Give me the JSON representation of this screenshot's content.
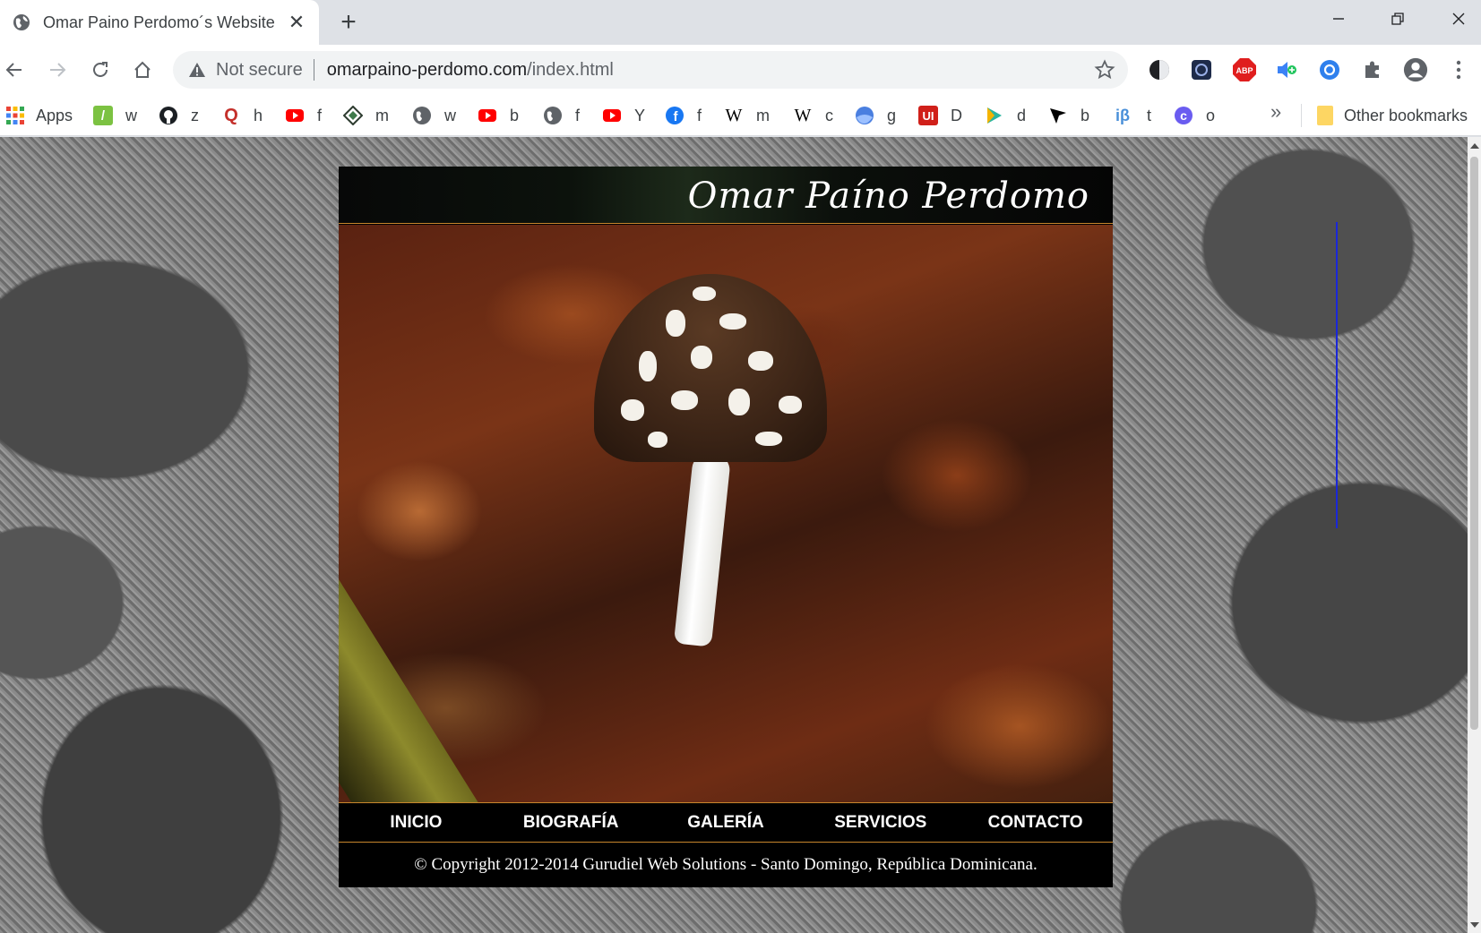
{
  "browser": {
    "tab_title": "Omar Paino Perdomo´s Website",
    "security_label": "Not secure",
    "url_host": "omarpaino-perdomo.com",
    "url_path": "/index.html"
  },
  "bookmarks": {
    "apps_label": "Apps",
    "items": [
      {
        "icon": "green-pencil-icon",
        "label": "w"
      },
      {
        "icon": "github-icon",
        "label": "z"
      },
      {
        "icon": "q-icon",
        "label": "h"
      },
      {
        "icon": "youtube-icon",
        "label": "f"
      },
      {
        "icon": "diamond-logo-icon",
        "label": "m"
      },
      {
        "icon": "globe-icon",
        "label": "w"
      },
      {
        "icon": "youtube-icon",
        "label": "b"
      },
      {
        "icon": "globe-icon",
        "label": "f"
      },
      {
        "icon": "youtube-icon",
        "label": "Y"
      },
      {
        "icon": "facebook-icon",
        "label": "f"
      },
      {
        "icon": "wikipedia-icon",
        "label": "m"
      },
      {
        "icon": "wikipedia-icon",
        "label": "c"
      },
      {
        "icon": "blue-sphere-icon",
        "label": "g"
      },
      {
        "icon": "ui-icon",
        "label": "D"
      },
      {
        "icon": "play-icon",
        "label": "d"
      },
      {
        "icon": "arrow-cursor-icon",
        "label": "b"
      },
      {
        "icon": "ib-icon",
        "label": "t"
      },
      {
        "icon": "c-icon",
        "label": "o"
      }
    ],
    "more_label": "»",
    "other_label": "Other bookmarks"
  },
  "site": {
    "title": "Omar Paíno Perdomo",
    "nav": [
      "INICIO",
      "BIOGRAFÍA",
      "GALERÍA",
      "SERVICIOS",
      "CONTACTO"
    ],
    "footer": "© Copyright 2012-2014 Gurudiel Web Solutions - Santo Domingo, República Dominicana."
  },
  "colors": {
    "accent_border": "#c8862c",
    "site_background": "#000000",
    "link_color": "#ffffff"
  }
}
